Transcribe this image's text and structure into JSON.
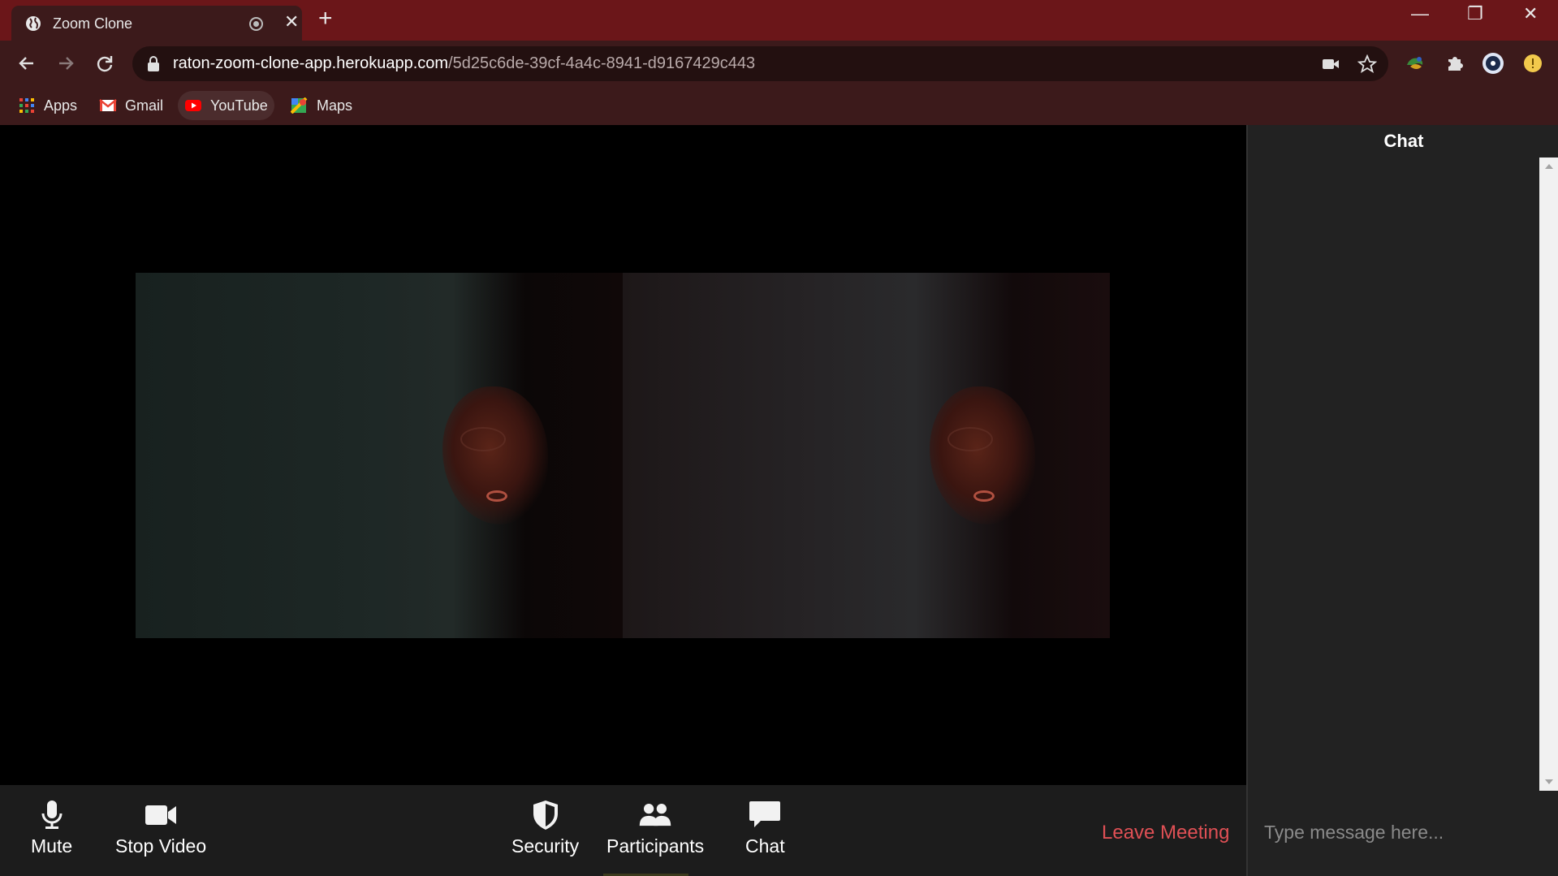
{
  "browser": {
    "tab_title": "Zoom Clone",
    "url_host": "raton-zoom-clone-app.herokuapp.com",
    "url_path": "/5d25c6de-39cf-4a4c-8941-d9167429c443",
    "bookmarks": [
      {
        "label": "Apps",
        "icon": "apps-grid-icon"
      },
      {
        "label": "Gmail",
        "icon": "gmail-icon"
      },
      {
        "label": "YouTube",
        "icon": "youtube-icon"
      },
      {
        "label": "Maps",
        "icon": "maps-icon"
      }
    ],
    "colors": {
      "frame": "#6b1619",
      "toolbar": "#3c1a1b",
      "omnibox": "#231010"
    }
  },
  "meeting": {
    "controls": {
      "mute": "Mute",
      "stop_video": "Stop Video",
      "security": "Security",
      "participants": "Participants",
      "chat": "Chat",
      "leave": "Leave Meeting"
    },
    "colors": {
      "control_bar": "#1c1c1c",
      "leave": "#e05055"
    }
  },
  "chat": {
    "header": "Chat",
    "input_placeholder": "Type message here..."
  }
}
